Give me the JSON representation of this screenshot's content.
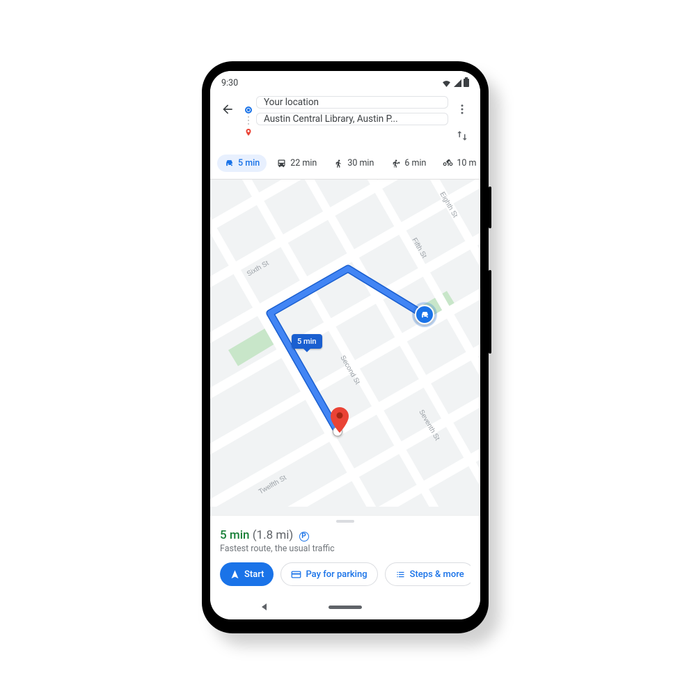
{
  "statusbar": {
    "time": "9:30"
  },
  "directions": {
    "origin": "Your location",
    "destination": "Austin Central Library, Austin P..."
  },
  "modes": [
    {
      "key": "drive",
      "label": "5 min",
      "selected": true
    },
    {
      "key": "transit",
      "label": "22 min",
      "selected": false
    },
    {
      "key": "walk",
      "label": "30 min",
      "selected": false
    },
    {
      "key": "ride",
      "label": "6 min",
      "selected": false
    },
    {
      "key": "bike",
      "label": "10 m",
      "selected": false
    }
  ],
  "map": {
    "streets": [
      "Eighth St",
      "Fifth St",
      "Sixth St",
      "Second St",
      "Seventh St",
      "Twelfth St"
    ],
    "route_badge": "5 min"
  },
  "summary": {
    "time": "5 min",
    "distance": "(1.8 mi)",
    "parking_badge": "P",
    "subtitle": "Fastest route, the usual traffic"
  },
  "actions": {
    "start": "Start",
    "pay": "Pay for parking",
    "steps": "Steps & more"
  }
}
